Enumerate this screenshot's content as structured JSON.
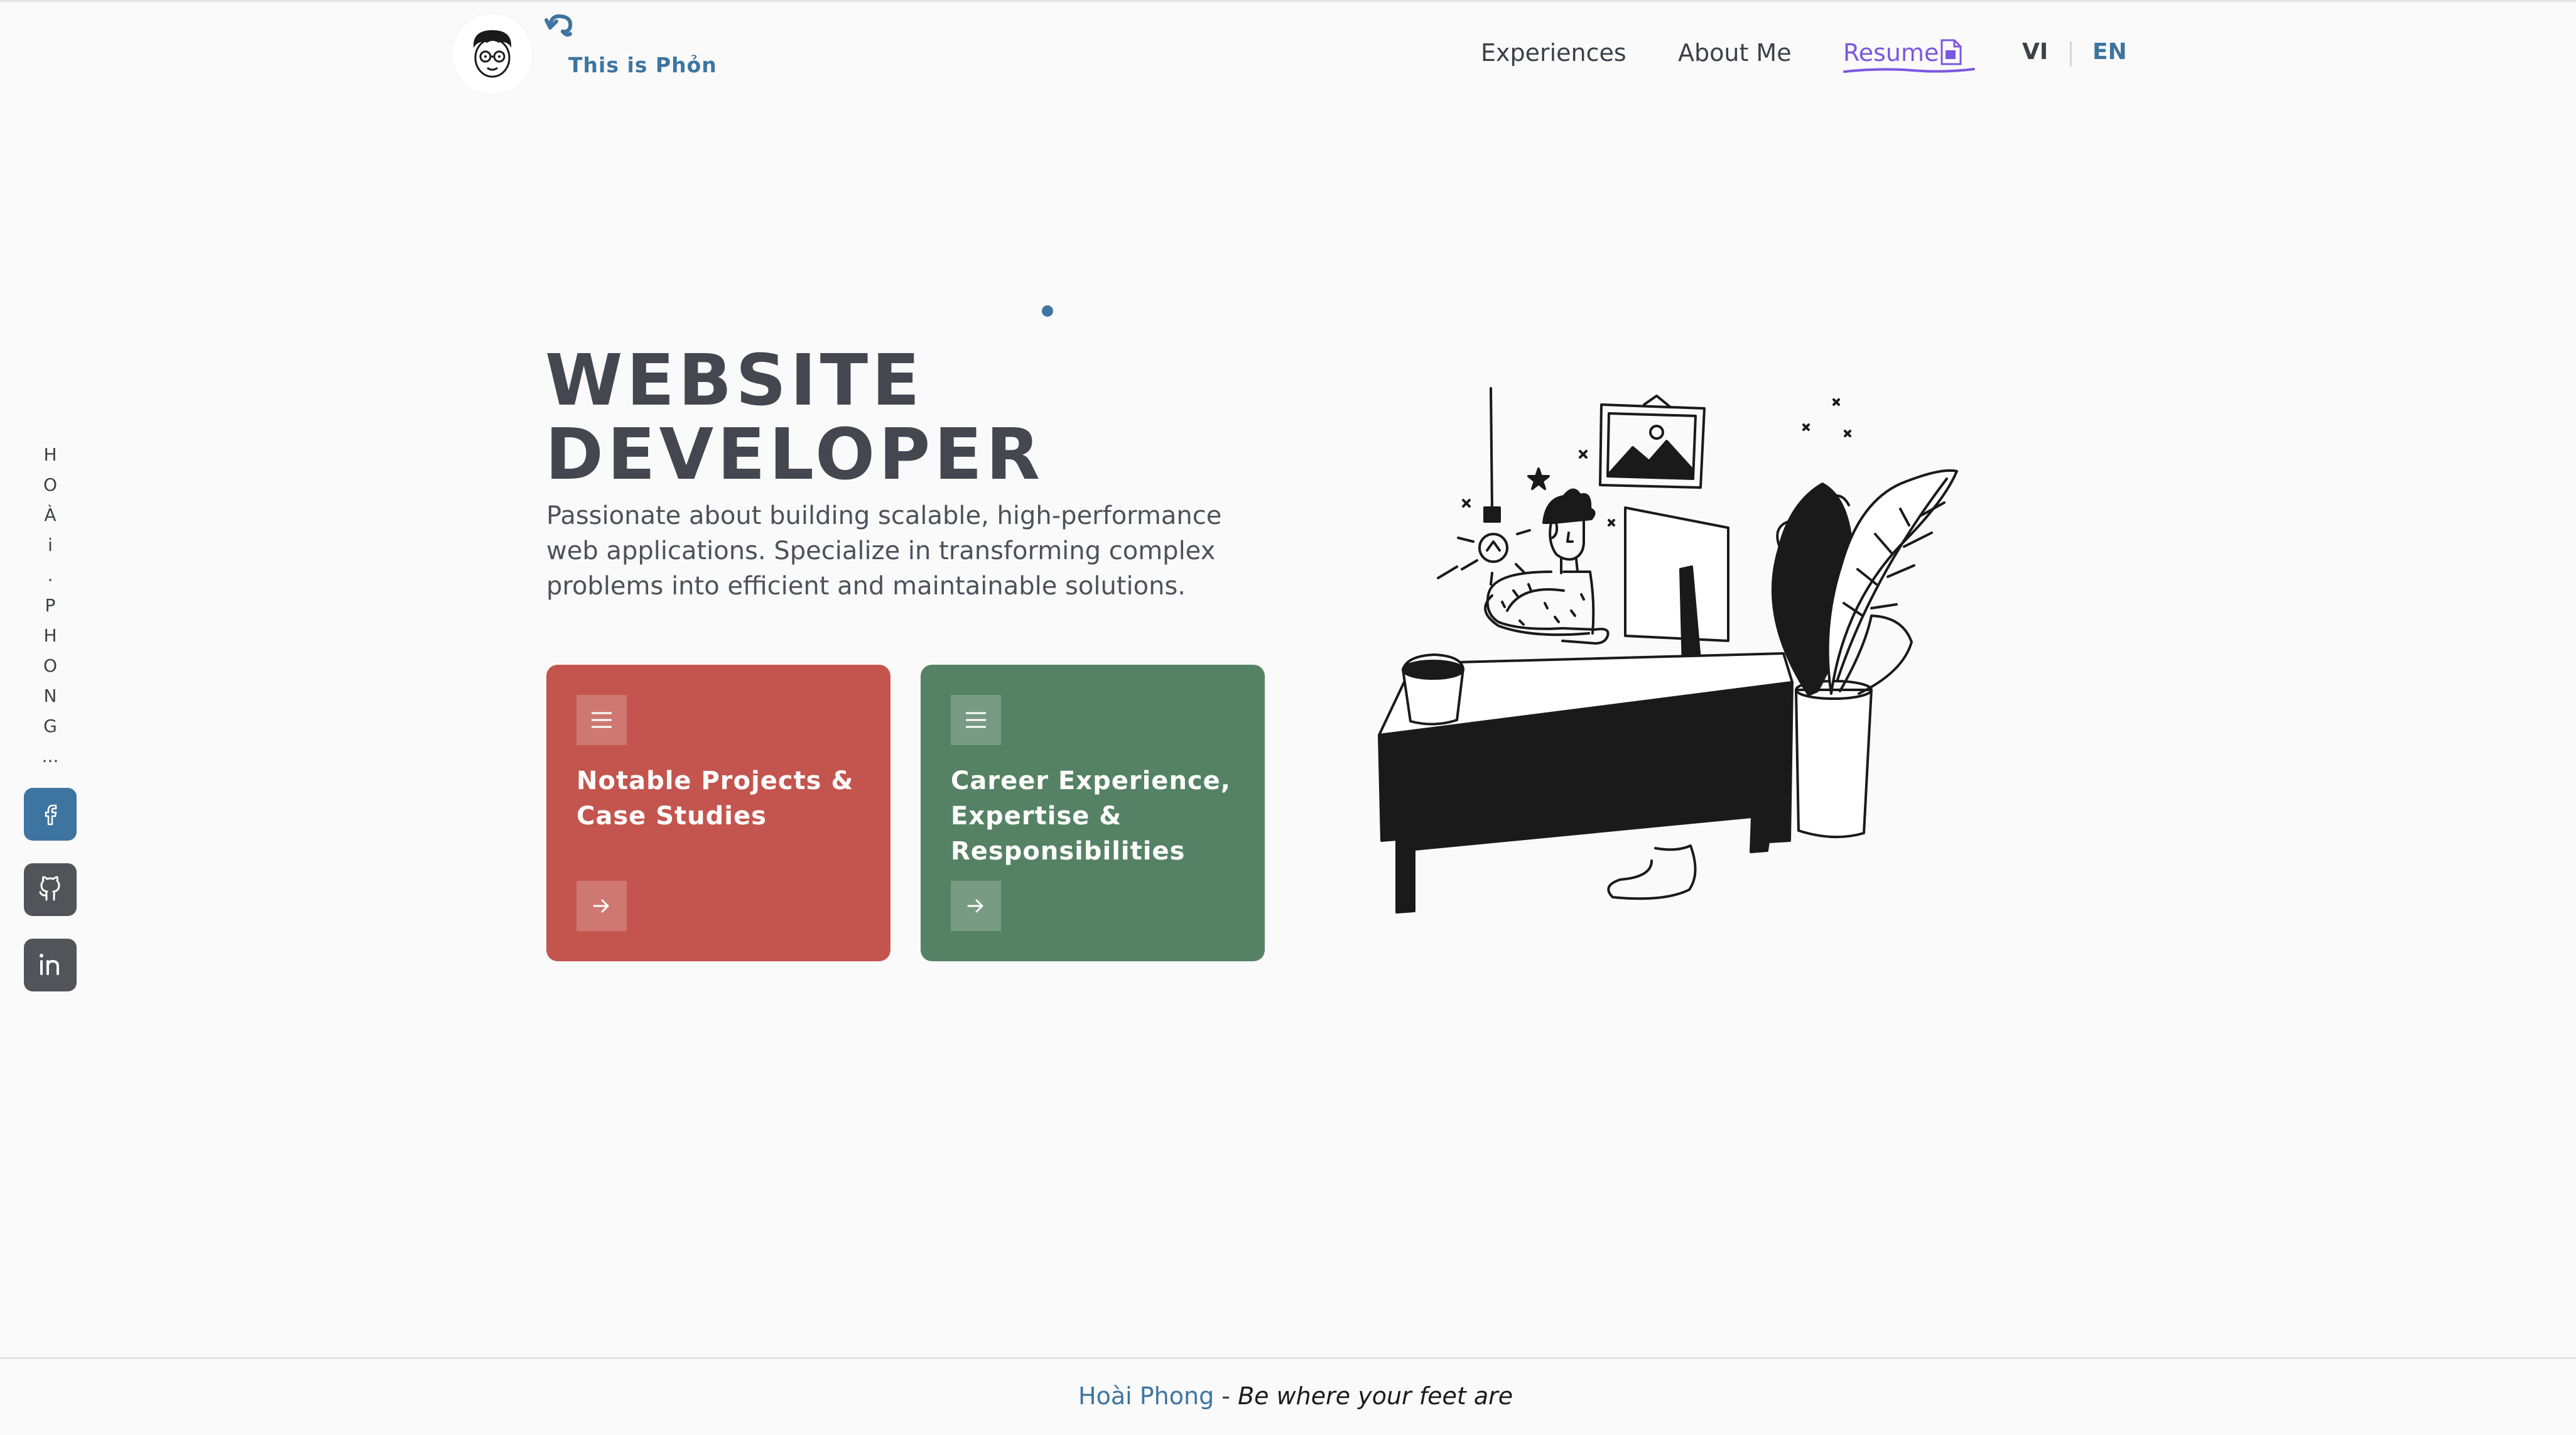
{
  "header": {
    "brand_text": "This is Phỏn",
    "nav": {
      "experiences": "Experiences",
      "about": "About Me",
      "resume": "Resume"
    },
    "lang": {
      "vi": "VI",
      "en": "EN"
    },
    "resume_accent": "#7b57e0",
    "brand_color": "#3e75a0"
  },
  "sidebar": {
    "name_letters": [
      "H",
      "O",
      "À",
      "i",
      ".",
      "P",
      "H",
      "O",
      "N",
      "G",
      "..."
    ],
    "social": [
      "facebook-icon",
      "github-icon",
      "linkedin-icon"
    ]
  },
  "hero": {
    "title_line1": "WEBSITE",
    "title_line2": "DEVELOPER",
    "description_lines": [
      "Passionate about building scalable, high-performance",
      "web applications. Specialize in transforming complex",
      "problems into efficient and maintainable solutions."
    ]
  },
  "cards": [
    {
      "lines": [
        "Notable Projects &",
        "Case Studies"
      ],
      "color": "#c4554e",
      "icon": "menu-icon",
      "arrow": "arrow-right-icon"
    },
    {
      "lines": [
        "Career Experience,",
        "Expertise &",
        "Responsibilities"
      ],
      "color": "#558264",
      "icon": "menu-icon",
      "arrow": "arrow-right-icon"
    }
  ],
  "footer": {
    "name": "Hoài Phong",
    "separator": " - ",
    "tagline": "Be where your feet are"
  }
}
